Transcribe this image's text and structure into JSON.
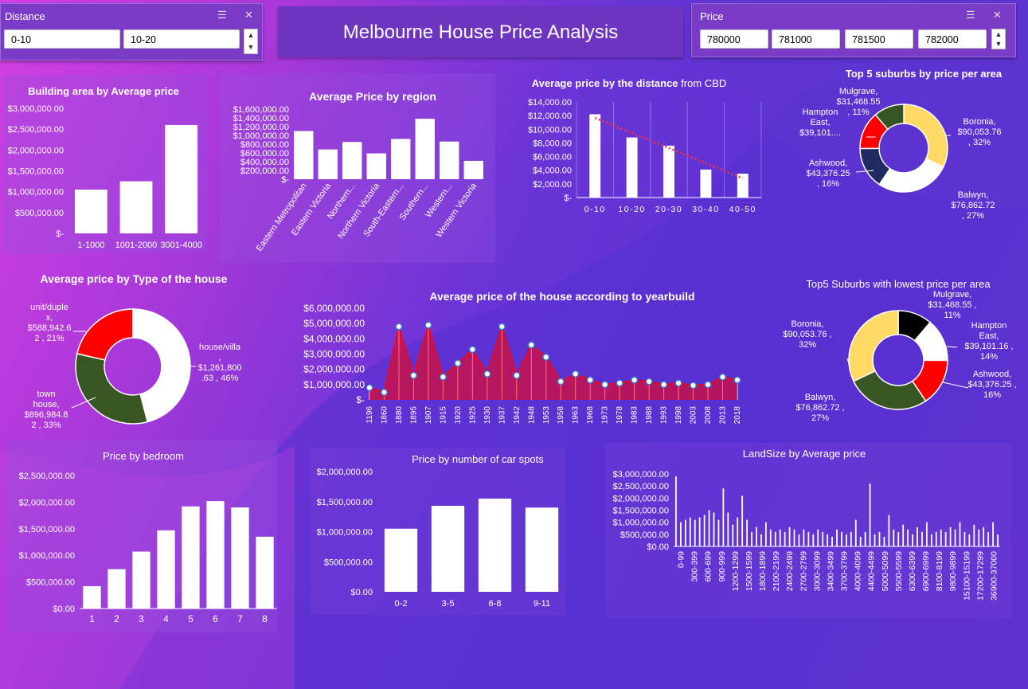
{
  "dashboard": {
    "title": "Melbourne House Price Analysis",
    "slicer_distance": {
      "label": "Distance",
      "items": [
        "0-10",
        "10-20"
      ]
    },
    "slicer_price": {
      "label": "Price",
      "items": [
        "780000",
        "781000",
        "781500",
        "782000"
      ]
    }
  },
  "colors": {
    "bar": "#ffffff",
    "red": "#ff0000",
    "green": "#375623",
    "yellow": "#ffd966",
    "navy": "#1f2a60",
    "black": "#000000",
    "trend": "#ff3333"
  },
  "chart_data": [
    {
      "id": "building-area",
      "type": "bar",
      "title": "Building area by Average price",
      "categories": [
        "1-1000",
        "1001-2000",
        "3001-4000"
      ],
      "values": [
        1050000,
        1250000,
        2600000
      ],
      "ylim": [
        0,
        3000000
      ],
      "yticks": [
        "$-",
        "$500,000.00",
        "$1,000,000.00",
        "$1,500,000.00",
        "$2,000,000.00",
        "$2,500,000.00",
        "$3,000,000.00"
      ]
    },
    {
      "id": "region",
      "type": "bar",
      "title": "Average Price by region",
      "categories": [
        "Eastern Metropolitan",
        "Eastern Victoria",
        "Northern...",
        "Northern Victoria",
        "South-Eastern...",
        "Southern...",
        "Western...",
        "Western Victoria"
      ],
      "values": [
        1100000,
        680000,
        850000,
        590000,
        920000,
        1380000,
        860000,
        420000
      ],
      "ylim": [
        0,
        1600000
      ],
      "yticks": [
        "$-",
        "$200,000.00",
        "$400,000.00",
        "$600,000.00",
        "$800,000.00",
        "$1,000,000.00",
        "$1,200,000.00",
        "$1,400,000.00",
        "$1,600,000.00"
      ]
    },
    {
      "id": "distance-cbd",
      "type": "bar",
      "title": "Average price by the distance",
      "title_suffix": " from CBD",
      "categories": [
        "0-10",
        "10-20",
        "20-30",
        "30-40",
        "40-50"
      ],
      "values": [
        12200,
        8800,
        7600,
        4100,
        3500
      ],
      "ylim": [
        0,
        14000
      ],
      "yticks": [
        "$-",
        "$2,000.00",
        "$4,000.00",
        "$6,000.00",
        "$8,000.00",
        "$10,000.00",
        "$12,000.00",
        "$14,000.00"
      ],
      "trendline": true
    },
    {
      "id": "top5-high",
      "type": "pie",
      "title": "Top 5 suburbs by price per area",
      "slices": [
        {
          "name": "Boronia",
          "value": 90053.76,
          "pct": 32,
          "label": [
            "Boronia,",
            "$90,053.76",
            ", 32%"
          ]
        },
        {
          "name": "Balwyn",
          "value": 76862.72,
          "pct": 27,
          "label": [
            "Balwyn,",
            "$76,862.72",
            ", 27%"
          ]
        },
        {
          "name": "Ashwood",
          "value": 43376.25,
          "pct": 16,
          "label": [
            "Ashwood,",
            "$43,376.25",
            ", 16%"
          ]
        },
        {
          "name": "Hampton East",
          "value": 39101,
          "pct": 14,
          "label": [
            "Hampton",
            "East,",
            "$39,101...."
          ]
        },
        {
          "name": "Mulgrave",
          "value": 31468.55,
          "pct": 11,
          "label": [
            "Mulgrave,",
            "$31,468.55",
            ", 11%"
          ]
        }
      ]
    },
    {
      "id": "house-type",
      "type": "pie",
      "title": "Average price by Type of the house",
      "slices": [
        {
          "name": "house/villa",
          "value": 1261800.63,
          "pct": 46,
          "label": [
            "house/villa",
            ",",
            "$1,261,800",
            ".63 , 46%"
          ]
        },
        {
          "name": "town house",
          "value": 896984.82,
          "pct": 33,
          "label": [
            "town",
            "house,",
            "$896,984.8",
            "2 , 33%"
          ]
        },
        {
          "name": "unit/duplex",
          "value": 588942.62,
          "pct": 21,
          "label": [
            "unit/duple",
            "x,",
            "$588,942.6",
            "2 , 21%"
          ]
        }
      ]
    },
    {
      "id": "yearbuild",
      "type": "line",
      "title": "Average price of the house according to yearbuild",
      "x": [
        "1196",
        "1860",
        "1880",
        "1895",
        "1907",
        "1915",
        "1920",
        "1925",
        "1930",
        "1937",
        "1942",
        "1948",
        "1953",
        "1958",
        "1963",
        "1968",
        "1973",
        "1978",
        "1983",
        "1988",
        "1993",
        "1998",
        "2003",
        "2008",
        "2013",
        "2018"
      ],
      "values": [
        800000,
        500000,
        4800000,
        1600000,
        4900000,
        1500000,
        2400000,
        3300000,
        1700000,
        4800000,
        1600000,
        3600000,
        2800000,
        1200000,
        1700000,
        1300000,
        1000000,
        1100000,
        1300000,
        1200000,
        1000000,
        1100000,
        950000,
        1000000,
        1500000,
        1300000
      ],
      "ylim": [
        0,
        6000000
      ],
      "yticks": [
        "$-",
        "$1,000,000.00",
        "$2,000,000.00",
        "$3,000,000.00",
        "$4,000,000.00",
        "$5,000,000.00",
        "$6,000,000.00"
      ]
    },
    {
      "id": "top5-low",
      "type": "pie",
      "title": "Top5 Suburbs with lowest price per area",
      "slices": [
        {
          "name": "Mulgrave",
          "value": 31468.55,
          "pct": 11,
          "label": [
            "Mulgrave,",
            "$31,468.55 ,",
            "11%"
          ]
        },
        {
          "name": "Hampton East",
          "value": 39101.16,
          "pct": 14,
          "label": [
            "Hampton",
            "East,",
            "$39,101.16 ,",
            "14%"
          ]
        },
        {
          "name": "Ashwood",
          "value": 43376.25,
          "pct": 16,
          "label": [
            "Ashwood,",
            "$43,376.25 ,",
            "16%"
          ]
        },
        {
          "name": "Balwyn",
          "value": 76862.72,
          "pct": 27,
          "label": [
            "Balwyn,",
            "$76,862.72 ,",
            "27%"
          ]
        },
        {
          "name": "Boronia",
          "value": 90053.76,
          "pct": 32,
          "label": [
            "Boronia,",
            "$90,053.76 ,",
            "32%"
          ]
        }
      ]
    },
    {
      "id": "bedroom",
      "type": "bar",
      "title": "Price by bedroom",
      "categories": [
        "1",
        "2",
        "3",
        "4",
        "5",
        "6",
        "7",
        "8"
      ],
      "values": [
        420000,
        740000,
        1070000,
        1470000,
        1920000,
        2020000,
        1900000,
        1350000
      ],
      "ylim": [
        0,
        2500000
      ],
      "yticks": [
        "$0.00",
        "$500,000.00",
        "$1,000,000.00",
        "$1,500,000.00",
        "$2,000,000.00",
        "$2,500,000.00"
      ]
    },
    {
      "id": "car-spots",
      "type": "bar",
      "title": "Price by number of car spots",
      "categories": [
        "0-2",
        "3-5",
        "6-8",
        "9-11"
      ],
      "values": [
        1050000,
        1430000,
        1550000,
        1400000
      ],
      "ylim": [
        0,
        2000000
      ],
      "yticks": [
        "$0.00",
        "$500,000.00",
        "$1,000,000.00",
        "$1,500,000.00",
        "$2,000,000.00"
      ]
    },
    {
      "id": "landsize",
      "type": "bar",
      "title": "LandSize by Average price",
      "categories": [
        "0-99",
        "300-399",
        "600-699",
        "900-999",
        "1200-1299",
        "1500-1599",
        "1800-1899",
        "2100-2199",
        "2400-2499",
        "2700-2799",
        "3000-3099",
        "3400-3499",
        "3700-3799",
        "4000-4099",
        "4400-4499",
        "5000-5099",
        "5500-5599",
        "6300-6399",
        "6900-6999",
        "8100-8199",
        "9800-9899",
        "15100-15199",
        "17200-17299",
        "36900-37000"
      ],
      "values": [
        2900000,
        1000000,
        1100000,
        1200000,
        1100000,
        1200000,
        1300000,
        1500000,
        1400000,
        1100000,
        2400000,
        1400000,
        900000,
        1200000,
        2100000,
        1100000,
        600000,
        800000,
        500000,
        1000000,
        700000,
        600000,
        700000,
        600000,
        800000,
        700000,
        500000,
        700000,
        600000,
        500000,
        700000,
        600000,
        500000,
        400000,
        700000,
        600000,
        500000,
        600000,
        1100000,
        400000,
        600000,
        2600000,
        500000,
        600000,
        400000,
        1300000,
        700000,
        600000,
        900000,
        700000,
        500000,
        800000,
        600000,
        1000000,
        500000,
        600000,
        700000,
        600000,
        800000,
        700000,
        1000000,
        600000,
        500000,
        900000,
        700000,
        800000,
        600000,
        1000000,
        500000
      ],
      "ylim": [
        0,
        3000000
      ],
      "yticks": [
        "$0.00",
        "$500,000.00",
        "$1,000,000.00",
        "$1,500,000.00",
        "$2,000,000.00",
        "$2,500,000.00",
        "$3,000,000.00"
      ]
    }
  ]
}
